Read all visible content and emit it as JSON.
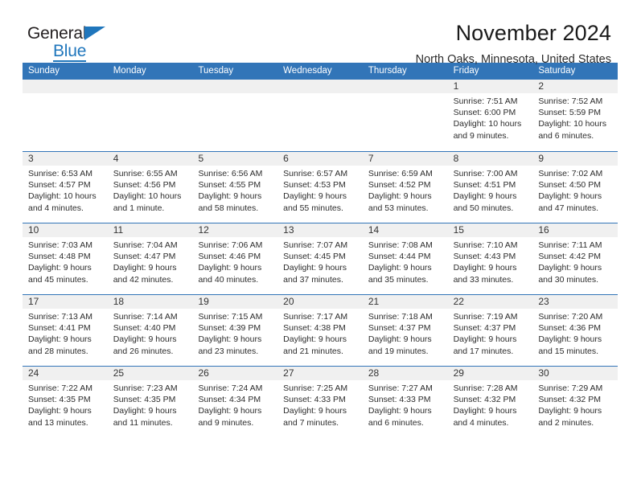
{
  "brand": {
    "word1": "General",
    "word2": "Blue",
    "triangle_color": "#1f76bc",
    "text_color": "#231f20"
  },
  "header": {
    "title": "November 2024",
    "subtitle": "North Oaks, Minnesota, United States"
  },
  "theme": {
    "header_blue": "#3275b8",
    "date_band_gray": "#f0f0f0",
    "text": "#2c2c2c"
  },
  "weekdays": [
    "Sunday",
    "Monday",
    "Tuesday",
    "Wednesday",
    "Thursday",
    "Friday",
    "Saturday"
  ],
  "weeks": [
    [
      {
        "day": "",
        "empty": true
      },
      {
        "day": "",
        "empty": true
      },
      {
        "day": "",
        "empty": true
      },
      {
        "day": "",
        "empty": true
      },
      {
        "day": "",
        "empty": true
      },
      {
        "day": "1",
        "sunrise": "Sunrise: 7:51 AM",
        "sunset": "Sunset: 6:00 PM",
        "daylight_1": "Daylight: 10 hours",
        "daylight_2": "and 9 minutes."
      },
      {
        "day": "2",
        "sunrise": "Sunrise: 7:52 AM",
        "sunset": "Sunset: 5:59 PM",
        "daylight_1": "Daylight: 10 hours",
        "daylight_2": "and 6 minutes."
      }
    ],
    [
      {
        "day": "3",
        "sunrise": "Sunrise: 6:53 AM",
        "sunset": "Sunset: 4:57 PM",
        "daylight_1": "Daylight: 10 hours",
        "daylight_2": "and 4 minutes."
      },
      {
        "day": "4",
        "sunrise": "Sunrise: 6:55 AM",
        "sunset": "Sunset: 4:56 PM",
        "daylight_1": "Daylight: 10 hours",
        "daylight_2": "and 1 minute."
      },
      {
        "day": "5",
        "sunrise": "Sunrise: 6:56 AM",
        "sunset": "Sunset: 4:55 PM",
        "daylight_1": "Daylight: 9 hours",
        "daylight_2": "and 58 minutes."
      },
      {
        "day": "6",
        "sunrise": "Sunrise: 6:57 AM",
        "sunset": "Sunset: 4:53 PM",
        "daylight_1": "Daylight: 9 hours",
        "daylight_2": "and 55 minutes."
      },
      {
        "day": "7",
        "sunrise": "Sunrise: 6:59 AM",
        "sunset": "Sunset: 4:52 PM",
        "daylight_1": "Daylight: 9 hours",
        "daylight_2": "and 53 minutes."
      },
      {
        "day": "8",
        "sunrise": "Sunrise: 7:00 AM",
        "sunset": "Sunset: 4:51 PM",
        "daylight_1": "Daylight: 9 hours",
        "daylight_2": "and 50 minutes."
      },
      {
        "day": "9",
        "sunrise": "Sunrise: 7:02 AM",
        "sunset": "Sunset: 4:50 PM",
        "daylight_1": "Daylight: 9 hours",
        "daylight_2": "and 47 minutes."
      }
    ],
    [
      {
        "day": "10",
        "sunrise": "Sunrise: 7:03 AM",
        "sunset": "Sunset: 4:48 PM",
        "daylight_1": "Daylight: 9 hours",
        "daylight_2": "and 45 minutes."
      },
      {
        "day": "11",
        "sunrise": "Sunrise: 7:04 AM",
        "sunset": "Sunset: 4:47 PM",
        "daylight_1": "Daylight: 9 hours",
        "daylight_2": "and 42 minutes."
      },
      {
        "day": "12",
        "sunrise": "Sunrise: 7:06 AM",
        "sunset": "Sunset: 4:46 PM",
        "daylight_1": "Daylight: 9 hours",
        "daylight_2": "and 40 minutes."
      },
      {
        "day": "13",
        "sunrise": "Sunrise: 7:07 AM",
        "sunset": "Sunset: 4:45 PM",
        "daylight_1": "Daylight: 9 hours",
        "daylight_2": "and 37 minutes."
      },
      {
        "day": "14",
        "sunrise": "Sunrise: 7:08 AM",
        "sunset": "Sunset: 4:44 PM",
        "daylight_1": "Daylight: 9 hours",
        "daylight_2": "and 35 minutes."
      },
      {
        "day": "15",
        "sunrise": "Sunrise: 7:10 AM",
        "sunset": "Sunset: 4:43 PM",
        "daylight_1": "Daylight: 9 hours",
        "daylight_2": "and 33 minutes."
      },
      {
        "day": "16",
        "sunrise": "Sunrise: 7:11 AM",
        "sunset": "Sunset: 4:42 PM",
        "daylight_1": "Daylight: 9 hours",
        "daylight_2": "and 30 minutes."
      }
    ],
    [
      {
        "day": "17",
        "sunrise": "Sunrise: 7:13 AM",
        "sunset": "Sunset: 4:41 PM",
        "daylight_1": "Daylight: 9 hours",
        "daylight_2": "and 28 minutes."
      },
      {
        "day": "18",
        "sunrise": "Sunrise: 7:14 AM",
        "sunset": "Sunset: 4:40 PM",
        "daylight_1": "Daylight: 9 hours",
        "daylight_2": "and 26 minutes."
      },
      {
        "day": "19",
        "sunrise": "Sunrise: 7:15 AM",
        "sunset": "Sunset: 4:39 PM",
        "daylight_1": "Daylight: 9 hours",
        "daylight_2": "and 23 minutes."
      },
      {
        "day": "20",
        "sunrise": "Sunrise: 7:17 AM",
        "sunset": "Sunset: 4:38 PM",
        "daylight_1": "Daylight: 9 hours",
        "daylight_2": "and 21 minutes."
      },
      {
        "day": "21",
        "sunrise": "Sunrise: 7:18 AM",
        "sunset": "Sunset: 4:37 PM",
        "daylight_1": "Daylight: 9 hours",
        "daylight_2": "and 19 minutes."
      },
      {
        "day": "22",
        "sunrise": "Sunrise: 7:19 AM",
        "sunset": "Sunset: 4:37 PM",
        "daylight_1": "Daylight: 9 hours",
        "daylight_2": "and 17 minutes."
      },
      {
        "day": "23",
        "sunrise": "Sunrise: 7:20 AM",
        "sunset": "Sunset: 4:36 PM",
        "daylight_1": "Daylight: 9 hours",
        "daylight_2": "and 15 minutes."
      }
    ],
    [
      {
        "day": "24",
        "sunrise": "Sunrise: 7:22 AM",
        "sunset": "Sunset: 4:35 PM",
        "daylight_1": "Daylight: 9 hours",
        "daylight_2": "and 13 minutes."
      },
      {
        "day": "25",
        "sunrise": "Sunrise: 7:23 AM",
        "sunset": "Sunset: 4:35 PM",
        "daylight_1": "Daylight: 9 hours",
        "daylight_2": "and 11 minutes."
      },
      {
        "day": "26",
        "sunrise": "Sunrise: 7:24 AM",
        "sunset": "Sunset: 4:34 PM",
        "daylight_1": "Daylight: 9 hours",
        "daylight_2": "and 9 minutes."
      },
      {
        "day": "27",
        "sunrise": "Sunrise: 7:25 AM",
        "sunset": "Sunset: 4:33 PM",
        "daylight_1": "Daylight: 9 hours",
        "daylight_2": "and 7 minutes."
      },
      {
        "day": "28",
        "sunrise": "Sunrise: 7:27 AM",
        "sunset": "Sunset: 4:33 PM",
        "daylight_1": "Daylight: 9 hours",
        "daylight_2": "and 6 minutes."
      },
      {
        "day": "29",
        "sunrise": "Sunrise: 7:28 AM",
        "sunset": "Sunset: 4:32 PM",
        "daylight_1": "Daylight: 9 hours",
        "daylight_2": "and 4 minutes."
      },
      {
        "day": "30",
        "sunrise": "Sunrise: 7:29 AM",
        "sunset": "Sunset: 4:32 PM",
        "daylight_1": "Daylight: 9 hours",
        "daylight_2": "and 2 minutes."
      }
    ]
  ]
}
